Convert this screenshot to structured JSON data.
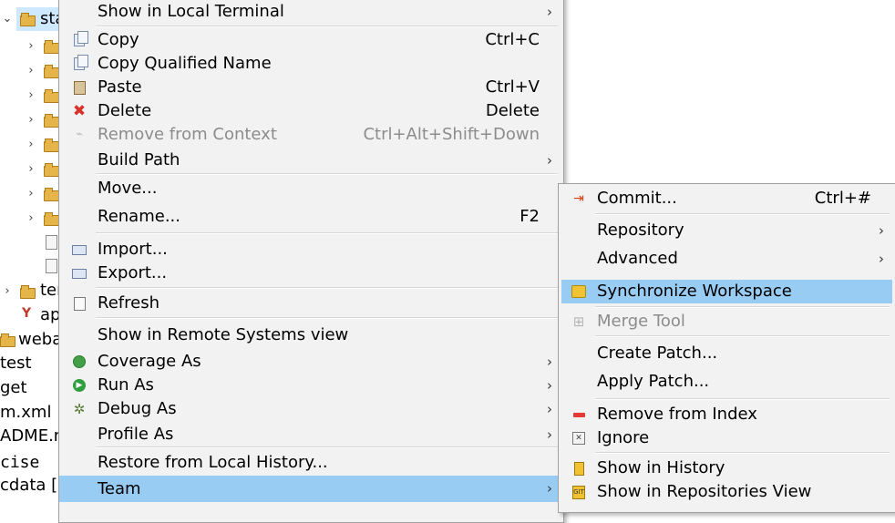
{
  "tree": {
    "rows": [
      {
        "label": "sta"
      },
      {
        "label": "ter"
      },
      {
        "label": "ap"
      },
      {
        "label": "weba"
      },
      {
        "label": "test"
      },
      {
        "label": "get"
      },
      {
        "label": "m.xml"
      },
      {
        "label": "ADME.m"
      },
      {
        "label": "cise"
      },
      {
        "label": "cdata [c"
      }
    ]
  },
  "context_menu": {
    "items": [
      {
        "label": "Show in Local Terminal"
      },
      {
        "label": "Copy",
        "shortcut": "Ctrl+C"
      },
      {
        "label": "Copy Qualified Name"
      },
      {
        "label": "Paste",
        "shortcut": "Ctrl+V"
      },
      {
        "label": "Delete",
        "shortcut": "Delete"
      },
      {
        "label": "Remove from Context",
        "shortcut": "Ctrl+Alt+Shift+Down"
      },
      {
        "label": "Build Path"
      },
      {
        "label": "Move..."
      },
      {
        "label": "Rename...",
        "shortcut": "F2"
      },
      {
        "label": "Import..."
      },
      {
        "label": "Export..."
      },
      {
        "label": "Refresh"
      },
      {
        "label": "Show in Remote Systems view"
      },
      {
        "label": "Coverage As"
      },
      {
        "label": "Run As"
      },
      {
        "label": "Debug As"
      },
      {
        "label": "Profile As"
      },
      {
        "label": "Restore from Local History..."
      },
      {
        "label": "Team"
      }
    ],
    "arrow": "›"
  },
  "team_submenu": {
    "items": [
      {
        "label": "Commit...",
        "shortcut": "Ctrl+#"
      },
      {
        "label": "Repository"
      },
      {
        "label": "Advanced"
      },
      {
        "label": "Synchronize Workspace"
      },
      {
        "label": "Merge Tool"
      },
      {
        "label": "Create Patch..."
      },
      {
        "label": "Apply Patch..."
      },
      {
        "label": "Remove from Index"
      },
      {
        "label": "Ignore"
      },
      {
        "label": "Show in History"
      },
      {
        "label": "Show in Repositories View"
      }
    ]
  },
  "colors": {
    "highlight": "#99ccf3",
    "menu_bg": "#f2f2f2",
    "disabled_text": "#8c8c8c",
    "tree_selection": "#cde8ff"
  },
  "icons": {
    "copy": "copy-icon",
    "copy_qualified": "copy-qualified-name-icon",
    "paste": "paste-icon",
    "delete": "delete-icon",
    "remove_context": "remove-from-context-icon",
    "import": "import-icon",
    "export": "export-icon",
    "refresh": "refresh-icon",
    "coverage": "coverage-icon",
    "run": "run-icon",
    "debug": "debug-icon",
    "commit": "commit-icon",
    "synchronize": "synchronize-icon",
    "merge": "merge-tool-icon",
    "remove_index": "remove-from-index-icon",
    "ignore": "ignore-icon",
    "history": "history-icon",
    "repositories": "repositories-icon"
  }
}
